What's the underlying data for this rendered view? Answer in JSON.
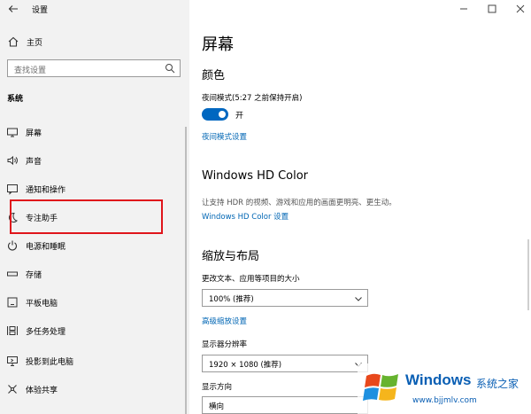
{
  "app": {
    "title": "设置"
  },
  "sidebar": {
    "home_label": "主页",
    "search_placeholder": "查找设置",
    "section_label": "系统",
    "items": [
      {
        "label": "屏幕",
        "icon": "monitor-icon"
      },
      {
        "label": "声音",
        "icon": "speaker-icon"
      },
      {
        "label": "通知和操作",
        "icon": "notification-icon"
      },
      {
        "label": "专注助手",
        "icon": "moon-icon"
      },
      {
        "label": "电源和睡眠",
        "icon": "power-icon"
      },
      {
        "label": "存储",
        "icon": "storage-icon"
      },
      {
        "label": "平板电脑",
        "icon": "tablet-icon"
      },
      {
        "label": "多任务处理",
        "icon": "multitask-icon"
      },
      {
        "label": "投影到此电脑",
        "icon": "project-icon"
      },
      {
        "label": "体验共享",
        "icon": "shared-experience-icon"
      }
    ]
  },
  "main": {
    "title": "屏幕",
    "color_heading": "颜色",
    "night_mode_label": "夜间模式(5:27 之前保持开启)",
    "toggle_state": "开",
    "night_settings_link": "夜间模式设置",
    "hd_heading": "Windows HD Color",
    "hd_desc": "让支持 HDR 的视频、游戏和应用的画面更明亮、更生动。",
    "hd_link": "Windows HD Color 设置",
    "scale_heading": "缩放与布局",
    "scale_label": "更改文本、应用等项目的大小",
    "scale_value": "100% (推荐)",
    "advanced_scale_link": "高级缩放设置",
    "resolution_label": "显示器分辨率",
    "resolution_value": "1920 × 1080 (推荐)",
    "orientation_label": "显示方向",
    "orientation_value": "横向"
  },
  "watermark": {
    "brand": "Windows",
    "brand2": "系统之家",
    "url": "www.bjjmlv.com"
  },
  "colors": {
    "accent": "#0067c0",
    "link": "#0066b4",
    "highlight": "#e0151b",
    "sidebar_bg": "#f2f2f2"
  }
}
